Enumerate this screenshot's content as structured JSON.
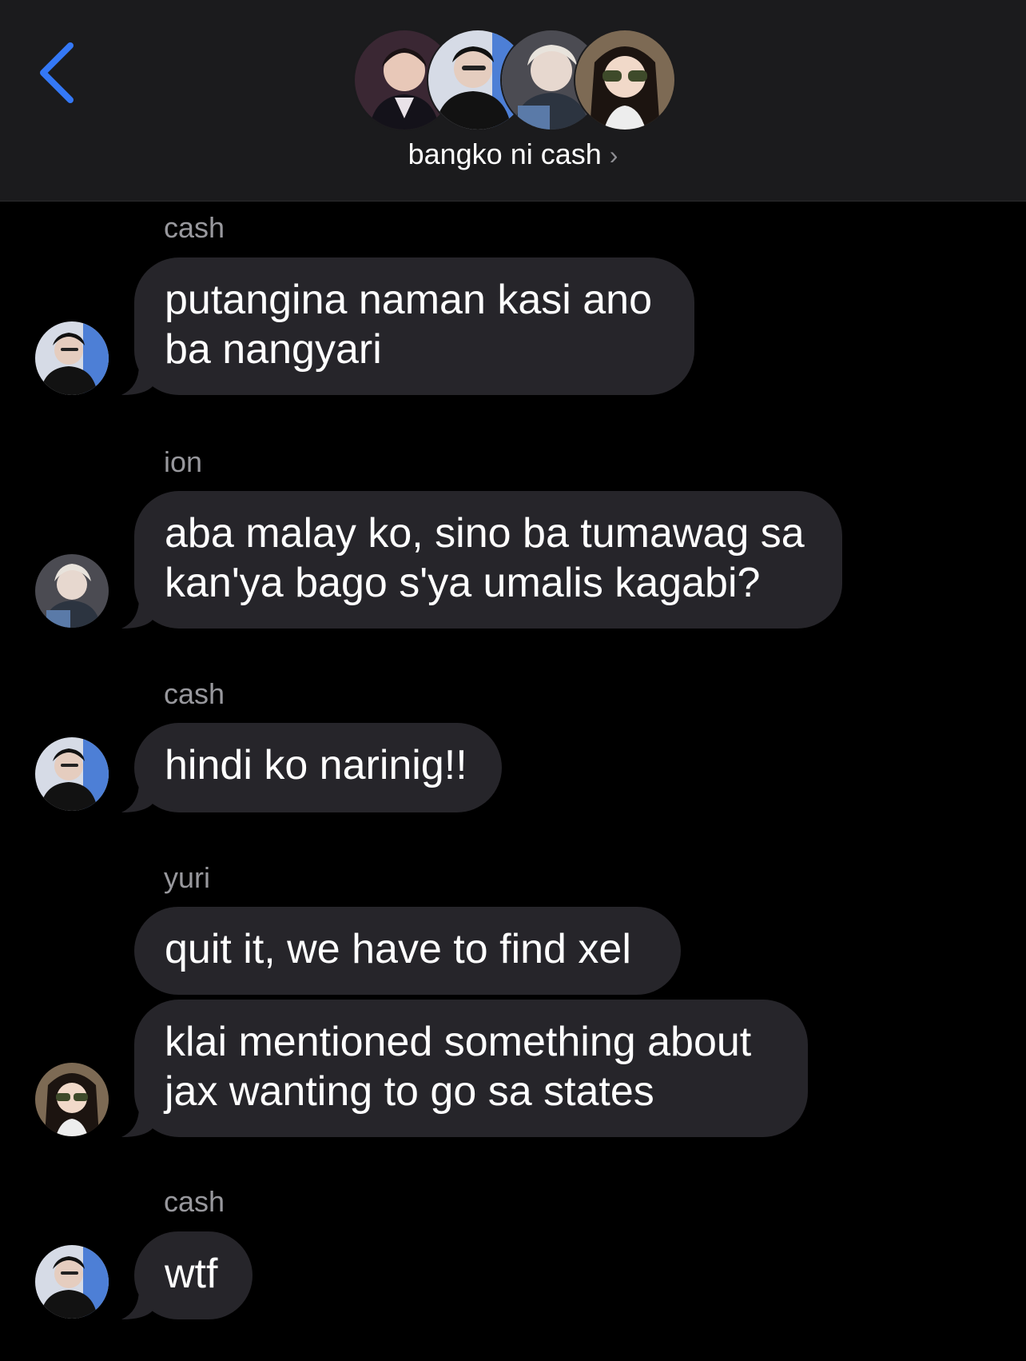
{
  "header": {
    "group_name": "bangko ni cash",
    "chevron": "›",
    "back_icon": "chevron-left-icon",
    "accent_color": "#3478f6"
  },
  "messages": [
    {
      "sender": "cash",
      "text": "putangina naman kasi ano ba nangyari"
    },
    {
      "sender": "ion",
      "text": "aba malay ko, sino ba tumawag sa kan'ya bago s'ya umalis kagabi?"
    },
    {
      "sender": "cash",
      "text": "hindi ko narinig!!"
    },
    {
      "sender": "yuri",
      "text": "quit it, we have to find xel"
    },
    {
      "sender": "",
      "text": "klai mentioned something about jax wanting to go sa states"
    },
    {
      "sender": "cash",
      "text": "wtf"
    }
  ]
}
